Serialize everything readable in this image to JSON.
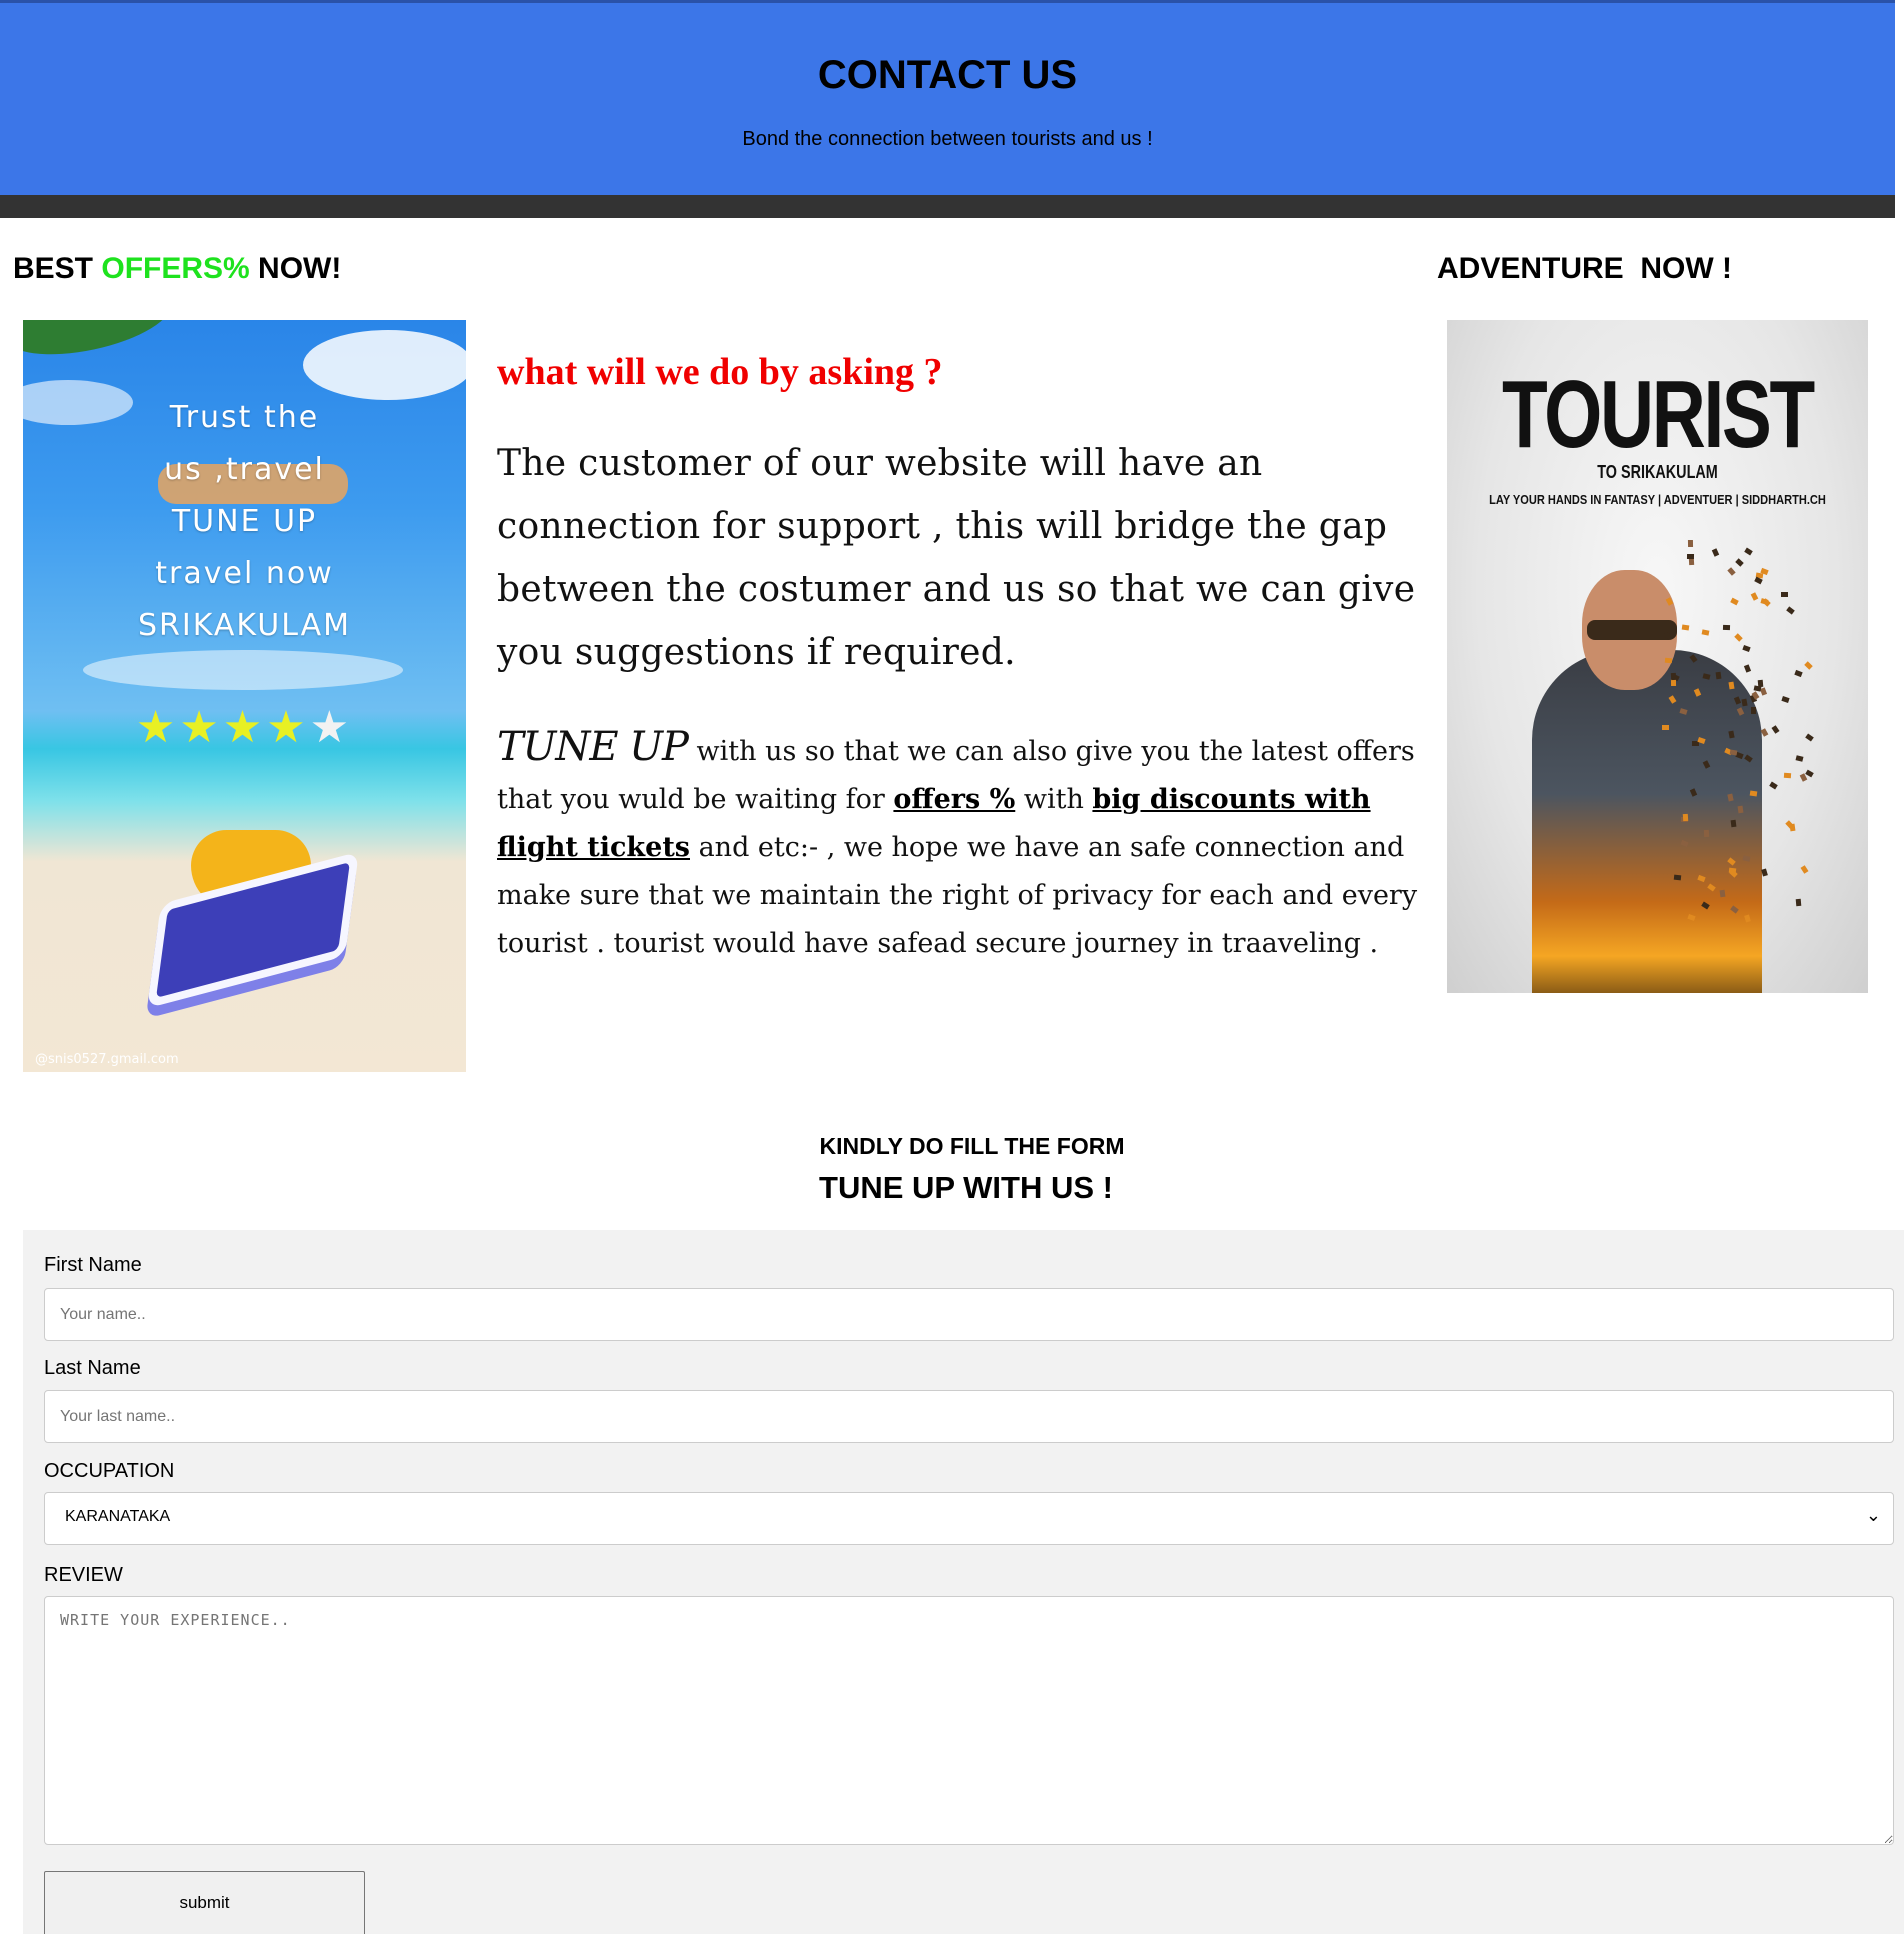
{
  "header": {
    "title": "CONTACT US",
    "subtitle": "Bond the connection between tourists and us !"
  },
  "offers": {
    "heading_prefix": "BEST ",
    "heading_highlight": "OFFERS%",
    "heading_suffix": " NOW!",
    "highlight_color": "#1ee21e",
    "poster": {
      "lines": [
        "Trust the",
        "us ,travel",
        "TUNE UP",
        "travel now",
        "SRIKAKULAM"
      ],
      "stars_filled": 4,
      "stars_total": 5,
      "credit": "@snis0527.gmail.com"
    }
  },
  "main": {
    "ask_heading": "what will we do by asking ?",
    "paragraph1": "The customer of our website will have an connection for support , this  will bridge the gap between the costumer and us so that we can give you suggestions if required.",
    "paragraph2": {
      "lead": "TUNE UP",
      "text1": " with us so that we can also give you the latest offers that you wuld be waiting for ",
      "link1": "offers %",
      "text2": " with ",
      "link2": "big discounts with flight tickets",
      "text3": " and etc:- , we hope we have an safe connection and make sure that we maintain the right of privacy for each and every tourist . tourist would have safead secure journey in traaveling ."
    }
  },
  "adventure": {
    "heading": "ADVENTURE  NOW !",
    "poster": {
      "title": "TOURIST",
      "subtitle": "TO SRIKAKULAM",
      "tagline": "LAY YOUR HANDS IN FANTASY | ADVENTUER | SIDDHARTH.CH"
    }
  },
  "form": {
    "heading": "KINDLY DO FILL THE FORM",
    "subheading": "TUNE UP WITH US !",
    "first_name_label": "First Name",
    "first_name_placeholder": "Your name..",
    "last_name_label": "Last Name",
    "last_name_placeholder": "Your last name..",
    "occupation_label": "OCCUPATION",
    "occupation_value": "KARANATAKA",
    "review_label": "REVIEW",
    "review_placeholder": "WRITE YOUR EXPERIENCE..",
    "submit_label": "submit"
  },
  "colors": {
    "header_bg": "#3c76e8",
    "header_bar": "#333333",
    "ask_heading": "#f00000",
    "form_bg": "#f2f2f2"
  },
  "icons": {
    "select_chevron": "chevron-down-icon",
    "star": "star-icon"
  }
}
